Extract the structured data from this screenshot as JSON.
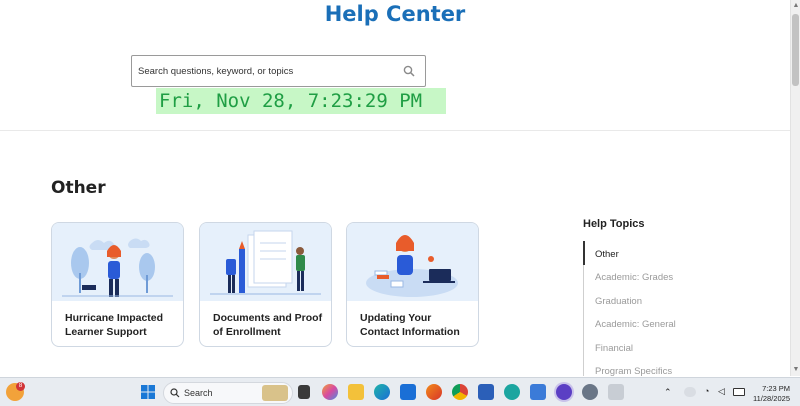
{
  "header": {
    "title": "Help Center"
  },
  "search": {
    "placeholder": "Search questions, keyword, or topics"
  },
  "clock": {
    "text": "Fri, Nov 28, 7:23:29 PM"
  },
  "section": {
    "title": "Other"
  },
  "cards": [
    {
      "label": "Hurricane Impacted Learner Support"
    },
    {
      "label": "Documents and Proof of Enrollment"
    },
    {
      "label": "Updating Your Contact Information"
    }
  ],
  "help_topics": {
    "title": "Help Topics",
    "items": [
      {
        "label": "Other",
        "active": true
      },
      {
        "label": "Academic: Grades",
        "active": false
      },
      {
        "label": "Graduation",
        "active": false
      },
      {
        "label": "Academic: General",
        "active": false
      },
      {
        "label": "Financial",
        "active": false
      },
      {
        "label": "Program Specifics",
        "active": false
      }
    ]
  },
  "taskbar": {
    "search_label": "Search",
    "notification_count": "8",
    "time": "7:23 PM",
    "date": "11/28/2025"
  },
  "colors": {
    "title_blue": "#1a6fb8",
    "clock_bg": "#c7f7c6",
    "clock_text": "#1f9e44",
    "card_art_bg": "#e6f0fb"
  }
}
